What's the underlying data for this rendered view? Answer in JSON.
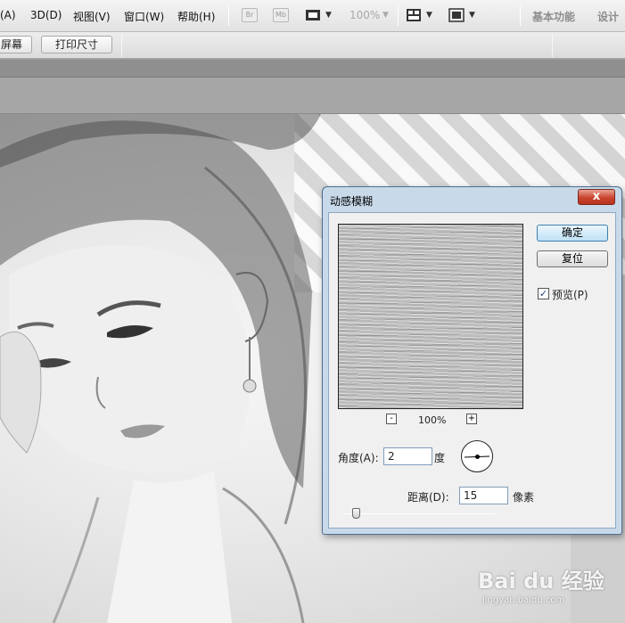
{
  "menubar": {
    "items": [
      "(A)",
      "3D(D)",
      "视图(V)",
      "窗口(W)",
      "帮助(H)"
    ],
    "bridge_label": "Br",
    "minibridge_label": "Mb",
    "zoom_level": "100%",
    "workspace": [
      "基本功能",
      "设计"
    ]
  },
  "options_bar": {
    "buttons": [
      "屏幕",
      "打印尺寸"
    ]
  },
  "dialog": {
    "title": "动感模糊",
    "close_label": "x",
    "ok_label": "确定",
    "reset_label": "复位",
    "preview_checked": true,
    "preview_check_glyph": "✓",
    "preview_label": "预览(P)",
    "zoom_out_label": "-",
    "zoom_in_label": "+",
    "zoom_percent": "100%",
    "angle_label": "角度(A):",
    "angle_value": "2",
    "angle_unit": "度",
    "distance_label": "距离(D):",
    "distance_value": "15",
    "distance_unit": "像素"
  },
  "watermark": {
    "text": "Bai du 经验",
    "sub": "jingyan.baidu.com"
  },
  "icons": [
    "frame-icon",
    "arrange-icon",
    "screen-mode-icon",
    "close-icon",
    "angle-dial-icon"
  ]
}
